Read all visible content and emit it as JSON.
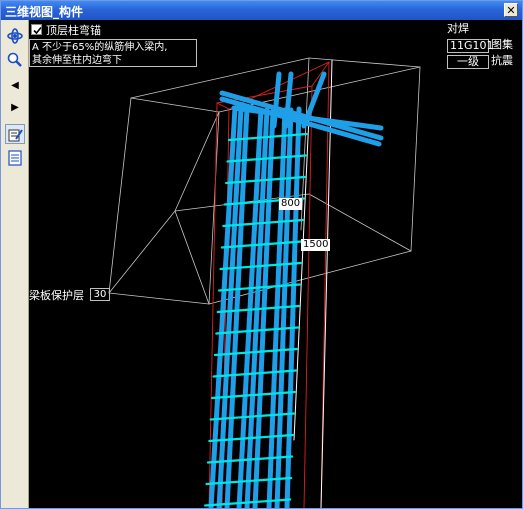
{
  "window": {
    "title": "三维视图_构件",
    "close_glyph": "✕"
  },
  "toolbar": {
    "items": [
      {
        "name": "rotate-icon",
        "glyph": ""
      },
      {
        "name": "zoom-icon",
        "glyph": ""
      },
      {
        "name": "prev-arrow-icon",
        "glyph": "◀"
      },
      {
        "name": "next-arrow-icon",
        "glyph": "▶"
      },
      {
        "name": "edit-icon",
        "glyph": ""
      },
      {
        "name": "list-icon",
        "glyph": ""
      }
    ]
  },
  "anchor": {
    "checked": true,
    "label": "顶层柱弯锚"
  },
  "note": {
    "line1": "A 不少于65%的纵筋伸入梁内,",
    "line2": "其余伸至柱内边弯下"
  },
  "info": {
    "row1": "对焊",
    "row2_code": "11G101",
    "row2_text": "图集",
    "row3_code": "一级",
    "row3_text": "抗震"
  },
  "cover": {
    "label": "梁板保护层",
    "value": "30"
  },
  "dimensions": {
    "d1": "800",
    "d2": "1500"
  },
  "colors": {
    "rebar": "#1e9fe8",
    "stirrup": "#00e6e6",
    "wire": "#c8c8c8",
    "outline": "#e02020"
  }
}
